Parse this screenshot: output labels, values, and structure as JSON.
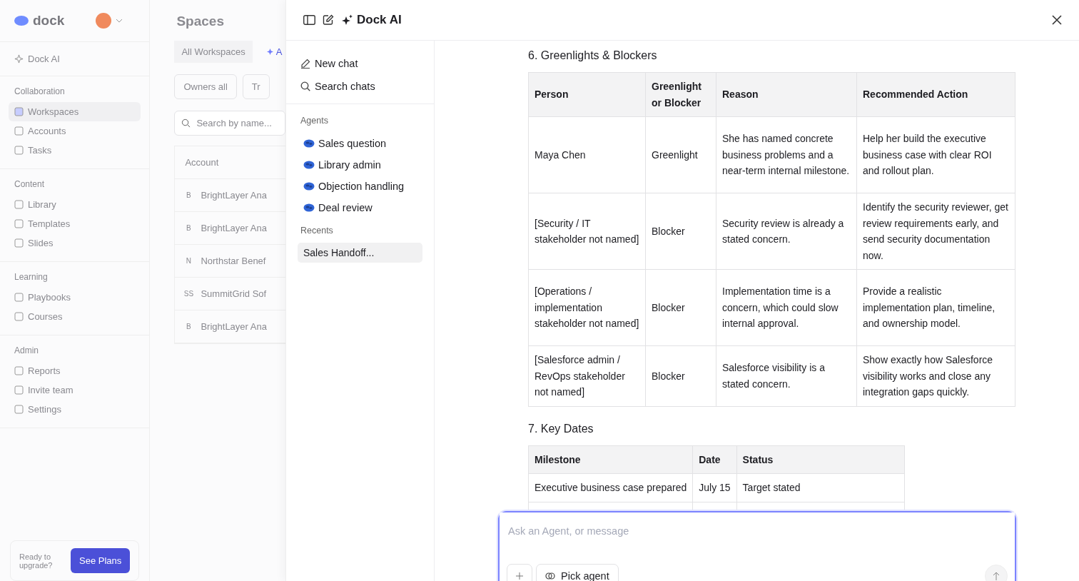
{
  "backdrop": {
    "logo": "dock",
    "assistant_link": "Dock AI",
    "nav_sections": [
      {
        "title": "Collaboration",
        "items": [
          {
            "label": "Workspaces",
            "selected": true
          },
          {
            "label": "Accounts",
            "selected": false
          },
          {
            "label": "Tasks",
            "selected": false
          }
        ]
      },
      {
        "title": "Content",
        "items": [
          {
            "label": "Library",
            "selected": false
          },
          {
            "label": "Templates",
            "selected": false
          },
          {
            "label": "Slides",
            "selected": false
          }
        ]
      },
      {
        "title": "Learning",
        "items": [
          {
            "label": "Playbooks",
            "selected": false
          },
          {
            "label": "Courses",
            "selected": false
          }
        ]
      },
      {
        "title": "Admin",
        "items": [
          {
            "label": "Reports",
            "selected": false
          },
          {
            "label": "Invite team",
            "selected": false
          },
          {
            "label": "Settings",
            "selected": false
          }
        ]
      }
    ],
    "upgrade": {
      "text": "Ready to upgrade?",
      "button": "See Plans"
    },
    "spaces": {
      "title": "Spaces",
      "tabs": [
        {
          "label": "All Workspaces",
          "selected": true
        },
        {
          "label": "A",
          "selected": false
        }
      ],
      "filters": [
        "Owners all",
        "Tr"
      ],
      "search": {
        "placeholder": "Search by name..."
      },
      "column": "Account",
      "rows": [
        {
          "initial": "B",
          "name": "BrightLayer Ana"
        },
        {
          "initial": "B",
          "name": "BrightLayer Ana"
        },
        {
          "initial": "N",
          "name": "Northstar Benef"
        },
        {
          "initial": "SS",
          "name": "SummitGrid Sof"
        },
        {
          "initial": "B",
          "name": "BrightLayer Ana"
        }
      ]
    }
  },
  "panel": {
    "title": "Dock AI",
    "actions": [
      "New chat",
      "Search chats"
    ],
    "agents_heading": "Agents",
    "agents": [
      "Sales question",
      "Library admin",
      "Objection handling",
      "Deal review"
    ],
    "recents_heading": "Recents",
    "recents": [
      {
        "label": "Sales Handoff...",
        "selected": true
      }
    ]
  },
  "chat": {
    "sections": [
      {
        "heading": "6. Greenlights & Blockers",
        "columns": [
          "Person",
          "Greenlight or Blocker",
          "Reason",
          "Recommended Action"
        ],
        "rows": [
          [
            "Maya Chen",
            "Greenlight",
            "She has named concrete business problems and a near-term internal milestone.",
            "Help her build the executive business case with clear ROI and rollout plan."
          ],
          [
            "[Security / IT stakeholder not named]",
            "Blocker",
            "Security review is already a stated concern.",
            "Identify the security reviewer, get review requirements early, and send security documentation now."
          ],
          [
            "[Operations / implementation stakeholder not named]",
            "Blocker",
            "Implementation time is a concern, which could slow internal approval.",
            "Provide a realistic implementation plan, timeline, and ownership model."
          ],
          [
            "[Salesforce admin / RevOps stakeholder not named]",
            "Blocker",
            "Salesforce visibility is a stated concern.",
            "Show exactly how Salesforce visibility works and close any integration gaps quickly."
          ]
        ]
      },
      {
        "heading": "7. Key Dates",
        "columns": [
          "Milestone",
          "Date",
          "Status"
        ],
        "rows": [
          [
            "Executive business case prepared",
            "July 15",
            "Target stated"
          ]
        ]
      }
    ],
    "composer": {
      "placeholder": "Ask an Agent, or message",
      "pick_agent": "Pick agent"
    }
  }
}
